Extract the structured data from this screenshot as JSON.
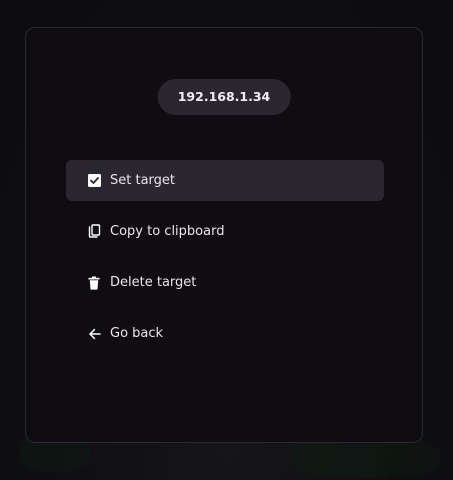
{
  "header": {
    "ip_address": "192.168.1.34"
  },
  "menu": {
    "items": [
      {
        "label": "Set target",
        "icon": "checkbox-checked-icon",
        "active": true
      },
      {
        "label": "Copy to clipboard",
        "icon": "copy-icon",
        "active": false
      },
      {
        "label": "Delete target",
        "icon": "trash-icon",
        "active": false
      },
      {
        "label": "Go back",
        "icon": "arrow-left-icon",
        "active": false
      }
    ]
  },
  "colors": {
    "panel_background": "#0f0d12",
    "panel_border": "#2b2a31",
    "highlight": "#2b2731",
    "text": "#e9e7ec"
  }
}
